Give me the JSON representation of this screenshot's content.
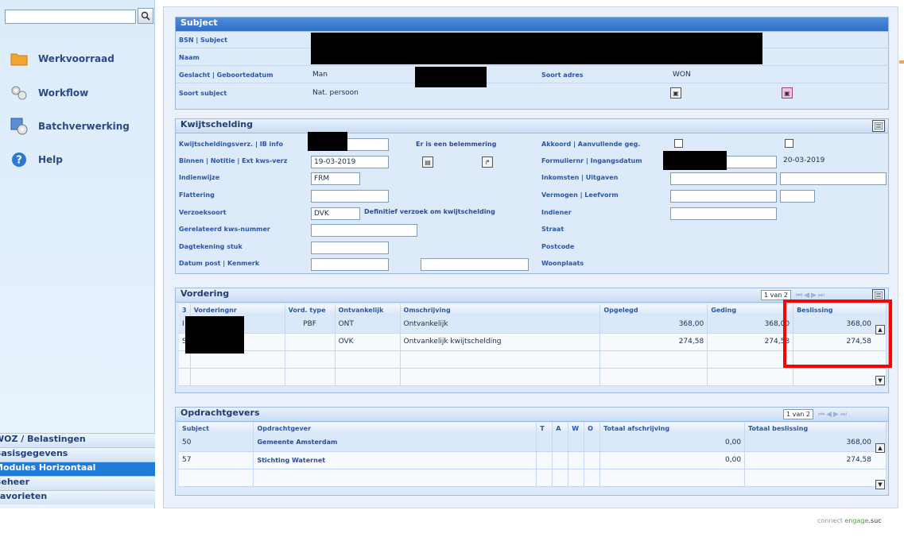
{
  "sidebar": {
    "search_placeholder": "",
    "items": [
      {
        "label": "Werkvoorraad",
        "icon": "folder-icon"
      },
      {
        "label": "Workflow",
        "icon": "workflow-icon"
      },
      {
        "label": "Batchverwerking",
        "icon": "batch-icon"
      },
      {
        "label": "Help",
        "icon": "help-icon"
      }
    ],
    "bottom_menu": [
      {
        "label": "WOZ / Belastingen",
        "active": false
      },
      {
        "label": "Basisgegevens",
        "active": false
      },
      {
        "label": "Modules Horizontaal",
        "active": true
      },
      {
        "label": "Beheer",
        "active": false
      },
      {
        "label": "Favorieten",
        "active": false
      }
    ]
  },
  "subject": {
    "title": "Subject",
    "labels": {
      "bsn": "BSN | Subject",
      "naam": "Naam",
      "geslacht": "Geslacht | Geboortedatum",
      "soort_subject": "Soort subject",
      "soort_adres": "Soort adres"
    },
    "geslacht_value": "Man",
    "soort_subject_value": "Nat. persoon",
    "soort_adres_value": "WON"
  },
  "kwijtschelding": {
    "title": "Kwijtschelding",
    "labels": {
      "verz": "Kwijtscheldingsverz. | IB info",
      "binnen": "Binnen | Notitie | Ext kws-verz",
      "indienwijze": "Indienwijze",
      "flattering": "Flattering",
      "verzoeksoort": "Verzoeksoort",
      "gerelateerd": "Gerelateerd kws-nummer",
      "dagtekening": "Dagtekening stuk",
      "datum_post": "Datum post | Kenmerk",
      "akkoord": "Akkoord | Aanvullende geg.",
      "formuliernr": "Formuliernr | Ingangsdatum",
      "inkomsten": "Inkomsten | Uitgaven",
      "vermogen": "Vermogen | Leefvorm",
      "indiener": "Indiener",
      "straat": "Straat",
      "postcode": "Postcode",
      "woonplaats": "Woonplaats"
    },
    "belemmering_text": "Er is een belemmering",
    "binnen_date": "19-03-2019",
    "ingangsdatum": "20-03-2019",
    "indienwijze_value": "FRM",
    "verzoeksoort_code": "DVK",
    "verzoeksoort_desc": "Definitief verzoek om kwijtschelding"
  },
  "vordering": {
    "title": "Vordering",
    "pager": "1 van 2",
    "columns": [
      "3",
      "Vorderingnr",
      "Vord. type",
      "Ontvankelijk",
      "Omschrijving",
      "Opgelegd",
      "Geding",
      "Beslissing"
    ],
    "rows": [
      {
        "prefix": "I",
        "type": "PBF",
        "ontv": "ONT",
        "omschrijving": "Ontvankelijk",
        "opgelegd": "368,00",
        "geding": "368,00",
        "beslissing": "368,00"
      },
      {
        "prefix": "S",
        "type": "",
        "ontv": "OVK",
        "omschrijving": "Ontvankelijk kwijtschelding",
        "opgelegd": "274,58",
        "geding": "274,58",
        "beslissing": "274,58"
      }
    ]
  },
  "opdrachtgevers": {
    "title": "Opdrachtgevers",
    "pager": "1 van 2",
    "columns": [
      "Subject",
      "Opdrachtgever",
      "T",
      "A",
      "W",
      "O",
      "Totaal afschrijving",
      "Totaal beslissing"
    ],
    "rows": [
      {
        "subject": "50",
        "naam": "Gemeente Amsterdam",
        "afschrijving": "0,00",
        "beslissing": "368,00"
      },
      {
        "subject": "57",
        "naam": "Stichting Waternet",
        "afschrijving": "0,00",
        "beslissing": "274,58"
      }
    ]
  },
  "brand": {
    "part1": "connect",
    "part2": " engage",
    "part3": ".suc"
  },
  "colors": {
    "highlight": "#ff0000",
    "active_menu": "#1e7bd8",
    "panel_header": "#2f6ec4"
  }
}
